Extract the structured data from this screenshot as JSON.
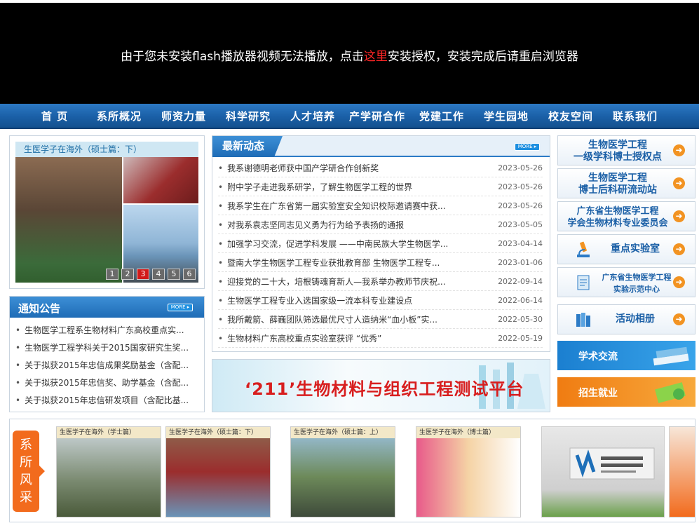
{
  "flash": {
    "before": "由于您未安装flash播放器视频无法播放，点击",
    "link": "这里",
    "after": "安装授权，安装完成后请重启浏览器"
  },
  "nav": [
    "首  页",
    "系所概况",
    "师资力量",
    "科学研究",
    "人才培养",
    "产学研合作",
    "党建工作",
    "学生园地",
    "校友空间",
    "联系我们"
  ],
  "slideshow": {
    "caption": "生医学子在海外（硕士篇：下）",
    "pages": [
      "1",
      "2",
      "3",
      "4",
      "5",
      "6"
    ],
    "active_page": "3"
  },
  "notice": {
    "title": "通知公告",
    "more": "MORE ▸",
    "items": [
      "生物医学工程系生物材料广东高校重点实...",
      "生物医学工程学科关于2015国家研究生奖...",
      "关于拟获2015年忠信成果奖励基金（含配...",
      "关于拟获2015年忠信奖、助学基金（含配...",
      "关于拟获2015年忠信研发项目（含配比基..."
    ]
  },
  "news": {
    "title": "最新动态",
    "more": "MORE ▸",
    "items": [
      {
        "title": "我系谢德明老师获中国产学研合作创新奖",
        "date": "2023-05-26"
      },
      {
        "title": "附中学子走进我系研学，了解生物医学工程的世界",
        "date": "2023-05-26"
      },
      {
        "title": "我系学生在广东省第一届实验室安全知识校际邀请赛中获...",
        "date": "2023-05-26"
      },
      {
        "title": "对我系袁志坚同志见义勇为行为给予表扬的通报",
        "date": "2023-05-05"
      },
      {
        "title": "加强学习交流，促进学科发展 ——中南民族大学生物医学...",
        "date": "2023-04-14"
      },
      {
        "title": "暨南大学生物医学工程专业获批教育部 生物医学工程专...",
        "date": "2023-01-06"
      },
      {
        "title": "迎接党的二十大，培根铸魂育新人—我系举办教师节庆祝...",
        "date": "2022-09-14"
      },
      {
        "title": "生物医学工程专业入选国家级一流本科专业建设点",
        "date": "2022-06-14"
      },
      {
        "title": "我所戴箭、薛巍团队筛选最优尺寸人造纳米“血小板”实...",
        "date": "2022-05-30"
      },
      {
        "title": "生物材料广东高校重点实验室获评 “优秀”",
        "date": "2022-05-19"
      }
    ]
  },
  "platform": {
    "text": "‘211’生物材料与组织工程测试平台"
  },
  "right_buttons": [
    {
      "line1": "生物医学工程",
      "line2": "一级学科博士授权点"
    },
    {
      "line1": "生物医学工程",
      "line2": "博士后科研流动站"
    },
    {
      "line1": "广东省生物医学工程",
      "line2": "学会生物材料专业委员会"
    },
    {
      "line1": "重点实验室",
      "line2": ""
    },
    {
      "line1": "广东省生物医学工程",
      "line2": "实验示范中心"
    },
    {
      "line1": "活动相册",
      "line2": ""
    }
  ],
  "side_buttons": [
    {
      "label": "学术交流",
      "color": "#1e88d8"
    },
    {
      "label": "招生就业",
      "color": "#f28c1b"
    }
  ],
  "gallery": {
    "label": [
      "系",
      "所",
      "风",
      "采"
    ],
    "captions": [
      "生医学子在海外（学士篇）",
      "生医学子在海外（硕士篇：下）",
      "生医学子在海外（硕士篇：上）",
      "生医学子在海外（博士篇）",
      "",
      ""
    ]
  },
  "colors": {
    "nav": "#1a5fa6",
    "accent": "#f29322",
    "link_red": "#ff2626"
  }
}
